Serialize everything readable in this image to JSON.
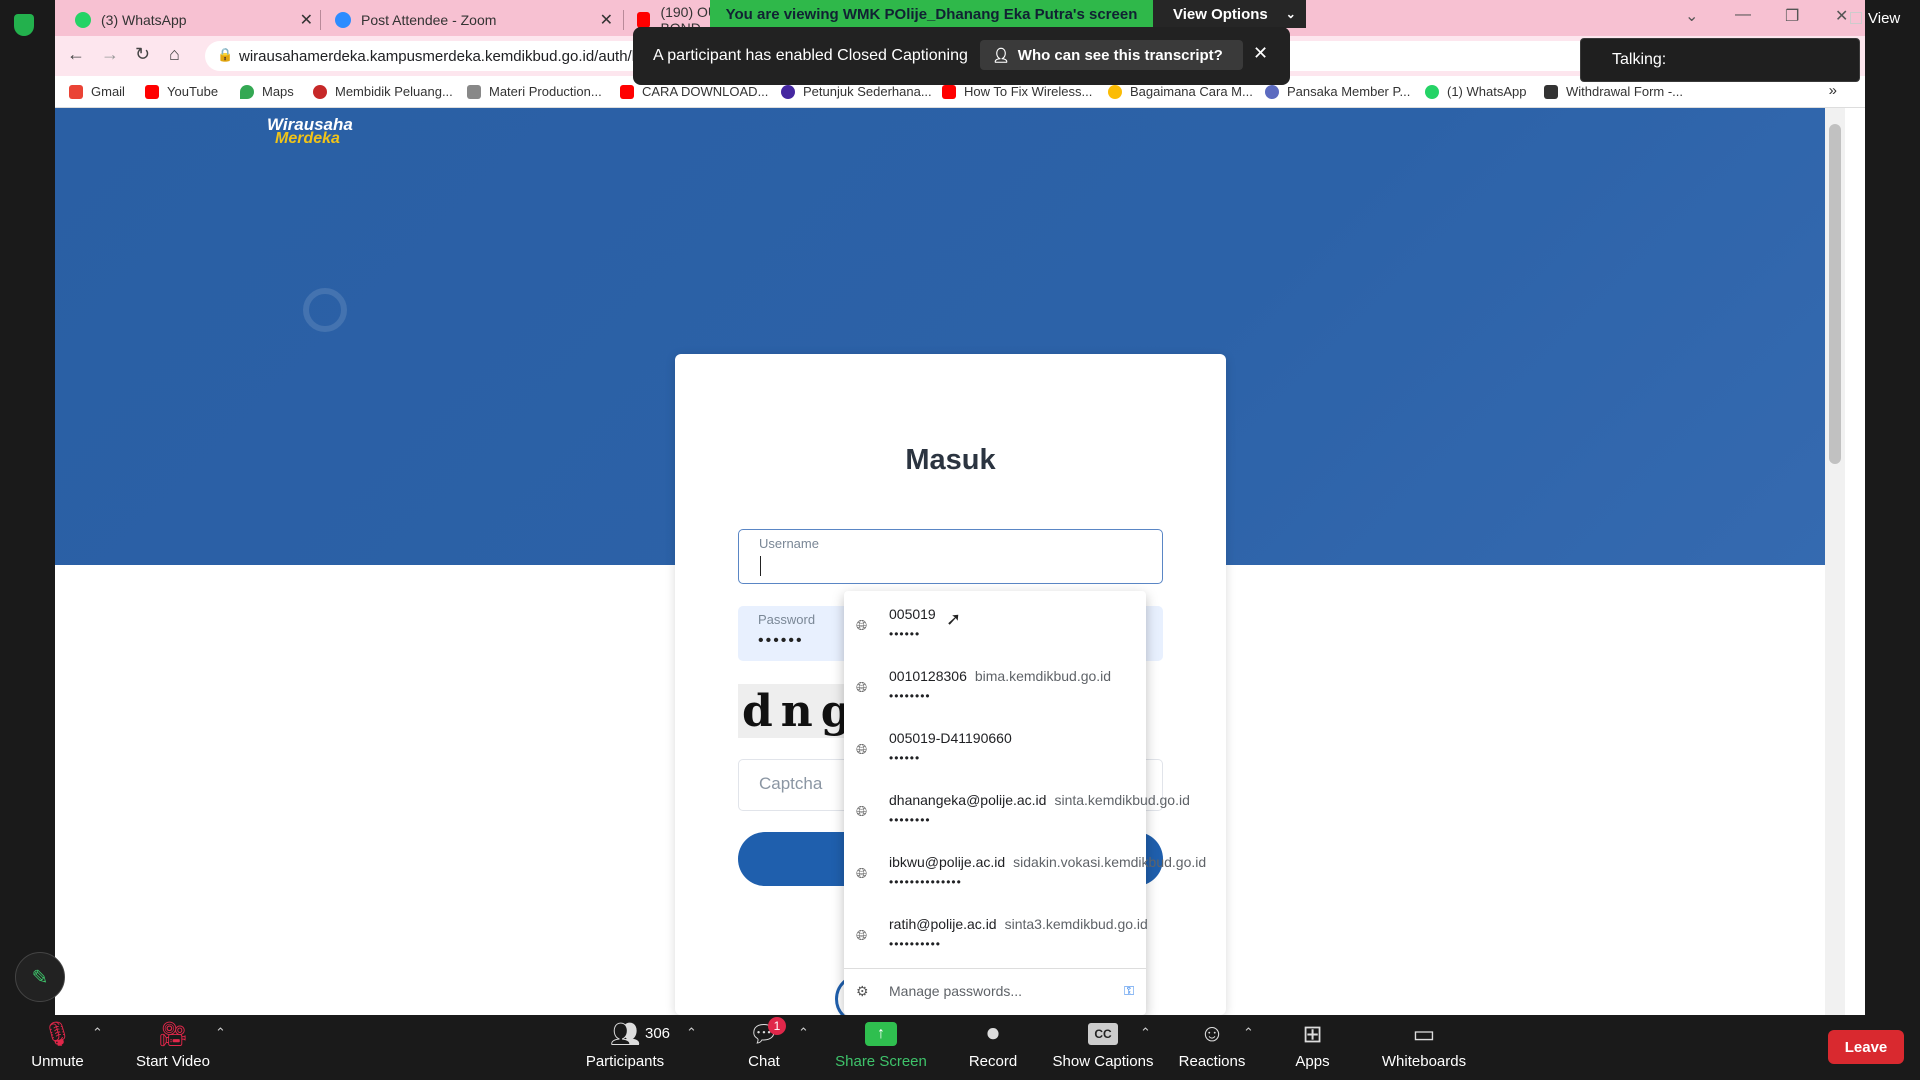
{
  "browser": {
    "tabs": [
      {
        "title": "(3) WhatsApp",
        "color": "#25d366"
      },
      {
        "title": "Post Attendee - Zoom",
        "color": "#2d8cff"
      },
      {
        "title": "(190) OUT BOND",
        "color": "#ff0000"
      }
    ],
    "url": "wirausahamerdeka.kampusmerdeka.kemdikbud.go.id/auth/logi",
    "bookmarks": [
      {
        "label": "Gmail",
        "color": "#ea4335"
      },
      {
        "label": "YouTube",
        "color": "#ff0000"
      },
      {
        "label": "Maps",
        "color": "#34a853"
      },
      {
        "label": "Membidik Peluang...",
        "color": "#c62828"
      },
      {
        "label": "Materi Production...",
        "color": "#888888"
      },
      {
        "label": "CARA DOWNLOAD...",
        "color": "#ff0000"
      },
      {
        "label": "Petunjuk Sederhana...",
        "color": "#4527a0"
      },
      {
        "label": "How To Fix Wireless...",
        "color": "#ff0000"
      },
      {
        "label": "Bagaimana Cara M...",
        "color": "#fbbc05"
      },
      {
        "label": "Pansaka Member P...",
        "color": "#5c6bc0"
      },
      {
        "label": "(1) WhatsApp",
        "color": "#25d366"
      },
      {
        "label": "Withdrawal Form -...",
        "color": "#333333"
      }
    ]
  },
  "page": {
    "logo_line1": "Wirausaha",
    "logo_line2": "Merdeka",
    "title": "Masuk",
    "username_label": "Username",
    "password_label": "Password",
    "password_value": "••••••",
    "captcha_text": "dng",
    "captcha_placeholder": "Captcha"
  },
  "autofill": {
    "items": [
      {
        "user": "005019",
        "site": "",
        "dots": "••••••"
      },
      {
        "user": "0010128306",
        "site": "bima.kemdikbud.go.id",
        "dots": "••••••••"
      },
      {
        "user": "005019-D41190660",
        "site": "",
        "dots": "••••••"
      },
      {
        "user": "dhanangeka@polije.ac.id",
        "site": "sinta.kemdikbud.go.id",
        "dots": "••••••••"
      },
      {
        "user": "ibkwu@polije.ac.id",
        "site": "sidakin.vokasi.kemdikbud.go.id",
        "dots": "••••••••••••••"
      },
      {
        "user": "ratih@polije.ac.id",
        "site": "sinta3.kemdikbud.go.id",
        "dots": "••••••••••"
      }
    ],
    "manage_label": "Manage passwords..."
  },
  "zoom": {
    "viewing_banner": "You are viewing WMK POlije_Dhanang Eka Putra's screen",
    "view_options": "View Options",
    "cc_message": "A participant has enabled Closed Captioning",
    "cc_who": "Who can see this transcript?",
    "talking": "Talking:",
    "view_top": "View",
    "participants_count": "306",
    "chat_badge": "1",
    "toolbar": {
      "unmute": "Unmute",
      "start_video": "Start Video",
      "participants": "Participants",
      "chat": "Chat",
      "share_screen": "Share Screen",
      "record": "Record",
      "show_captions": "Show Captions",
      "reactions": "Reactions",
      "apps": "Apps",
      "whiteboards": "Whiteboards",
      "leave": "Leave"
    },
    "accent_green": "#2fb84a",
    "leave_red": "#d9292f"
  }
}
